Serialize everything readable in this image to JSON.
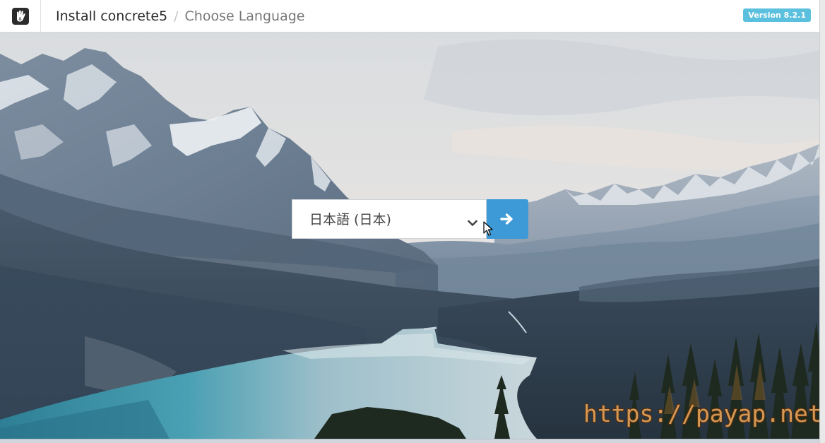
{
  "header": {
    "breadcrumb_root": "Install concrete5",
    "breadcrumb_separator": "/",
    "breadcrumb_current": "Choose Language",
    "version_badge": "Version 8.2.1"
  },
  "language_form": {
    "selected_language": "日本語 (日本)",
    "submit_icon": "arrow-right-icon"
  },
  "overlay": {
    "watermark": "https://payap.net/"
  },
  "colors": {
    "header_bg": "#ffffff",
    "badge_bg": "#5bc0de",
    "submit_bg": "#3d9ad7",
    "lake": "#4aa0b3"
  }
}
